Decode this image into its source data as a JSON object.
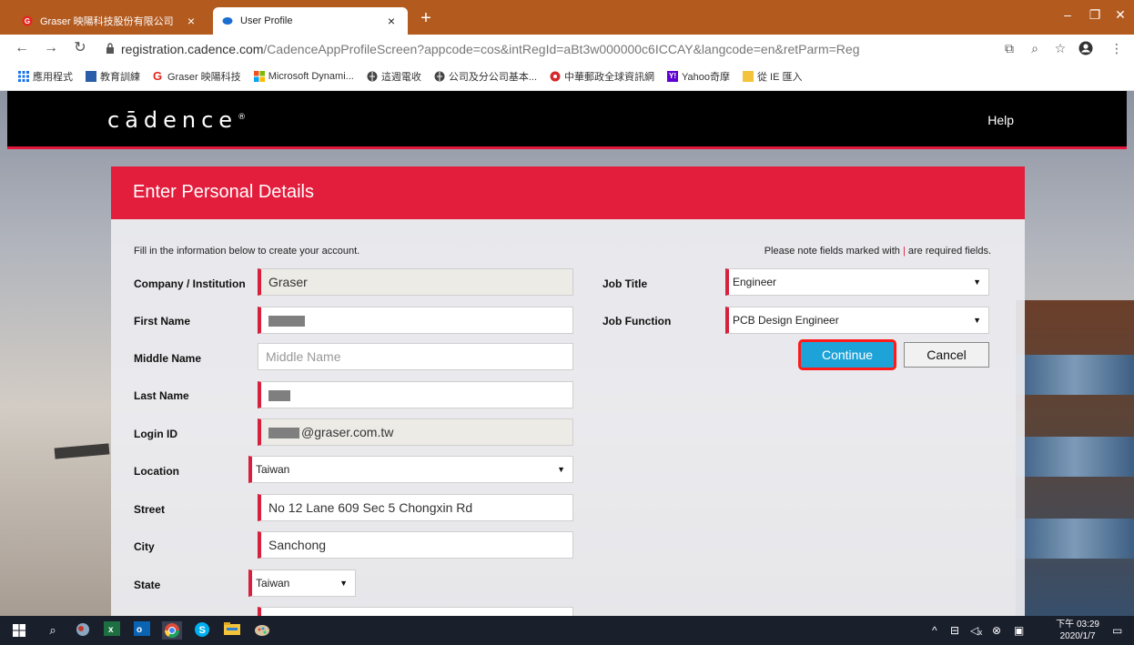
{
  "browser": {
    "tabs": [
      {
        "title": "Graser 映陽科技股份有限公司",
        "active": false
      },
      {
        "title": "User Profile",
        "active": true
      }
    ],
    "tab_close_glyph": "×",
    "new_tab_glyph": "+",
    "url_host": "registration.cadence.com",
    "url_path": "/CadenceAppProfileScreen?appcode=cos&intRegId=aBt3w000000c6ICCAY&langcode=en&retParm=Reg",
    "bookmarks": [
      {
        "label": "應用程式",
        "icon": "apps-grid-icon"
      },
      {
        "label": "教育訓練",
        "icon": "training-icon"
      },
      {
        "label": "Graser 映陽科技",
        "icon": "graser-logo-icon"
      },
      {
        "label": "Microsoft Dynami...",
        "icon": "microsoft-icon"
      },
      {
        "label": "這週電收",
        "icon": "globe-icon"
      },
      {
        "label": "公司及分公司基本...",
        "icon": "globe-icon"
      },
      {
        "label": "中華郵政全球資訊網",
        "icon": "post-icon"
      },
      {
        "label": "Yahoo奇摩",
        "icon": "yahoo-icon"
      },
      {
        "label": "從 IE 匯入",
        "icon": "folder-icon"
      }
    ]
  },
  "site": {
    "logo": "cādence",
    "logo_mark": "®",
    "help": "Help"
  },
  "form": {
    "title": "Enter Personal Details",
    "intro": "Fill in the information below to create your account.",
    "note_prefix": "Please note fields marked with",
    "note_bar": "|",
    "note_suffix": "are required fields.",
    "labels": {
      "company": "Company / Institution",
      "first_name": "First Name",
      "middle_name": "Middle Name",
      "last_name": "Last Name",
      "login_id": "Login ID",
      "location": "Location",
      "street": "Street",
      "city": "City",
      "state": "State",
      "job_title": "Job Title",
      "job_function": "Job Function"
    },
    "values": {
      "company": "Graser",
      "middle_name_placeholder": "Middle Name",
      "login_id_suffix": "@graser.com.tw",
      "location": "Taiwan",
      "street": "No 12 Lane 609 Sec 5 Chongxin Rd",
      "city": "Sanchong",
      "state": "Taiwan",
      "job_title": "Engineer",
      "job_function": "PCB Design Engineer"
    },
    "continue": "Continue",
    "cancel": "Cancel"
  },
  "taskbar": {
    "time": "下午 03:29",
    "date": "2020/1/7"
  },
  "colors": {
    "brand_red": "#e31d3c",
    "tab_strip": "#b35a1f",
    "continue_blue": "#1ea3d8",
    "highlight_red": "#ff1a1a"
  }
}
